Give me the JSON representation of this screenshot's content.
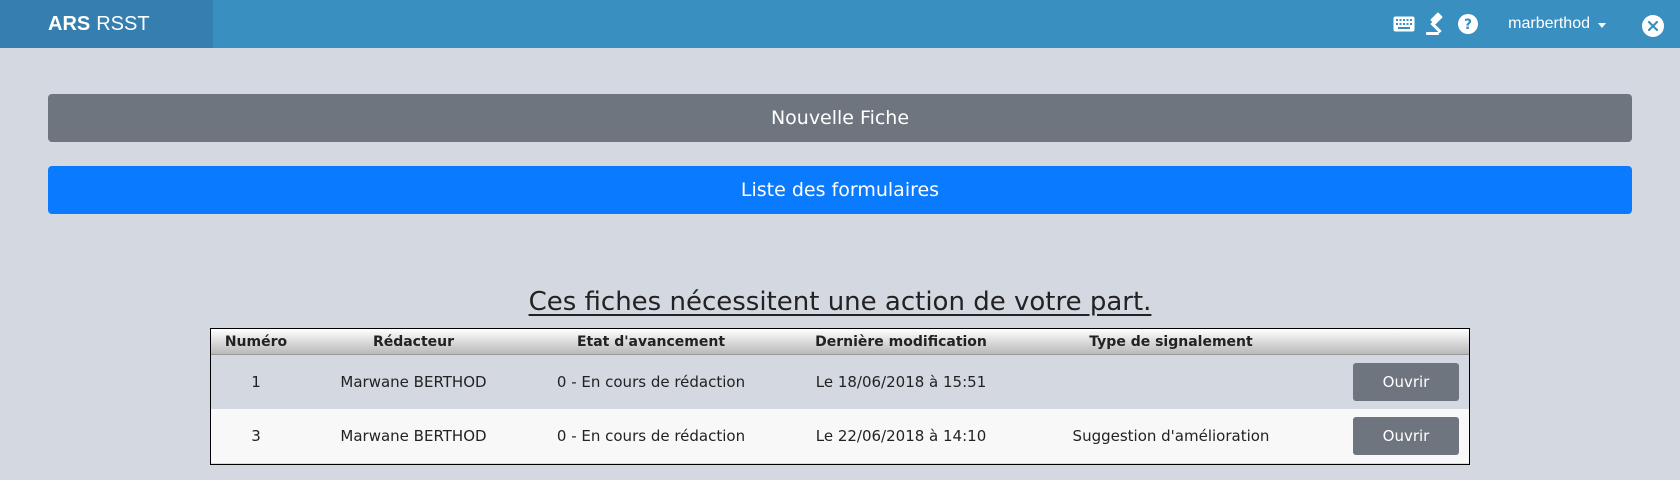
{
  "navbar": {
    "brand_bold": "ARS",
    "brand_rest": "RSST",
    "icons": [
      "keyboard-icon",
      "gavel-icon",
      "help-icon"
    ],
    "username": "marberthod",
    "accent_color": "#3a8fc1"
  },
  "actions": {
    "new_form_label": "Nouvelle Fiche",
    "list_forms_label": "Liste des formulaires"
  },
  "section": {
    "title": "Ces fiches nécessitent une action de votre part."
  },
  "table": {
    "headers": [
      "Numéro",
      "Rédacteur",
      "Etat d'avancement",
      "Dernière modification",
      "Type de signalement",
      ""
    ],
    "rows": [
      {
        "numero": "1",
        "redacteur": "Marwane BERTHOD",
        "etat": "0 - En cours de rédaction",
        "modification": "Le 18/06/2018 à 15:51",
        "type": "",
        "action": "Ouvrir"
      },
      {
        "numero": "3",
        "redacteur": "Marwane BERTHOD",
        "etat": "0 - En cours de rédaction",
        "modification": "Le 22/06/2018 à 14:10",
        "type": "Suggestion d'amélioration",
        "action": "Ouvrir"
      }
    ]
  }
}
